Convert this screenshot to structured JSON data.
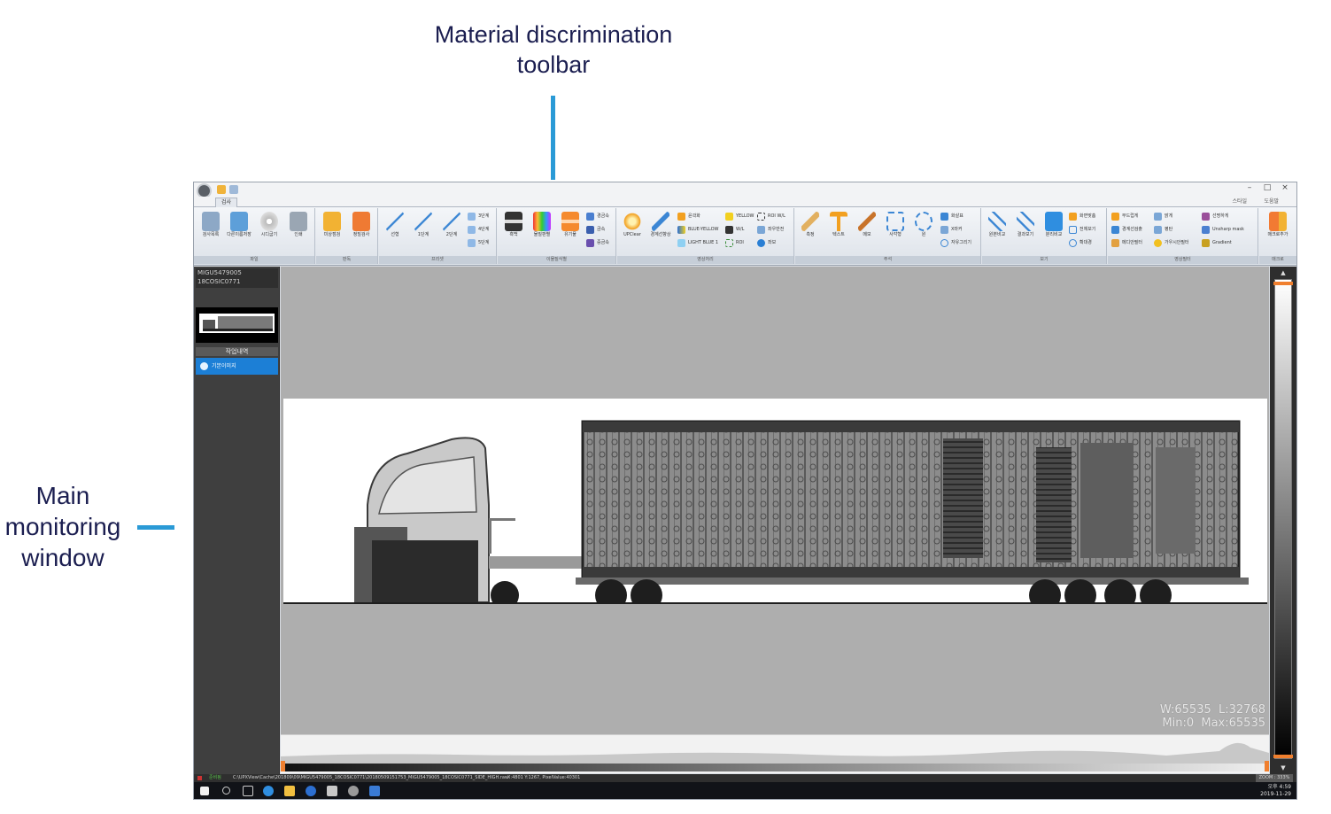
{
  "annotations": {
    "toolbar_caption_line1": "Material discrimination",
    "toolbar_caption_line2": "toolbar",
    "window_caption_line1": "Main",
    "window_caption_line2": "monitoring",
    "window_caption_line3": "window",
    "accent_color": "#2a9ad6",
    "text_color": "#1b1e50"
  },
  "titlebar": {
    "tab_label": "검사",
    "user": "스타일",
    "theme": "도움말",
    "minimize": "–",
    "maximize": "□",
    "close": "×"
  },
  "ribbon": {
    "groups": [
      {
        "caption": "파일",
        "buttons": [
          "검사목록",
          "다른이름저장",
          "시디굽기",
          "인쇄"
        ]
      },
      {
        "caption": "판독",
        "buttons": [
          "미상점검",
          "정밀검사"
        ]
      },
      {
        "caption": "프리셋",
        "buttons": [
          "선형",
          "1단계",
          "2단계"
        ],
        "small": [
          "3단계",
          "4단계",
          "5단계"
        ]
      },
      {
        "caption": "이물질식별",
        "buttons": [
          "흑백",
          "물질판별",
          "유기물"
        ],
        "small": [
          "경금속",
          "금속",
          "중금속"
        ]
      },
      {
        "caption": "영상처리",
        "buttons": [
          "UPClear",
          "경계선향상"
        ],
        "small": [
          "윤곽화",
          "BLUE-YELLOW",
          "LIGHT BLUE 1",
          "YELLOW",
          "W/L",
          "ROI",
          "ROI W/L",
          "좌우반전",
          "좌보"
        ]
      },
      {
        "caption": "주석",
        "buttons": [
          "측정",
          "텍스트",
          "메모",
          "사각형",
          "원"
        ],
        "small": [
          "화살표",
          "X마커",
          "자유그리기"
        ]
      },
      {
        "caption": "보기",
        "buttons": [
          "원본비교",
          "결과보기",
          "분리비교"
        ],
        "small": [
          "화면맞춤",
          "전체보기",
          "확대경"
        ]
      },
      {
        "caption": "영상필터",
        "small": [
          "부드럽게",
          "경계선검출",
          "메디안필터",
          "밝게",
          "평탄",
          "가우시안필터",
          "선명하게",
          "Unsharp mask",
          "Gradient"
        ]
      },
      {
        "caption": "매크로",
        "buttons": [
          "매크로추가"
        ]
      }
    ]
  },
  "left_panel": {
    "id_line1": "MIGU5479005",
    "id_line2": "18COSIC0771",
    "history_header": "작업내역",
    "history_item": "기본이미지"
  },
  "viewer": {
    "window_width": "W:65535",
    "window_level": "L:32768",
    "min_value": "Min:0",
    "max_value": "Max:65535"
  },
  "statusbar": {
    "mode": "준비됨",
    "path": "C:\\UPXView\\Cache\\201809\\09\\MIGU5479005_18COSIC0771\\20180509151753_MIGU5479005_18COSIC0771_SIDE_HIGH.raw",
    "position": "X:4801 Y:1267, PixelValue:40301",
    "zoom": "ZOOM : 333%"
  },
  "taskbar": {
    "time": "오후 4:59",
    "date": "2019-11-29"
  }
}
